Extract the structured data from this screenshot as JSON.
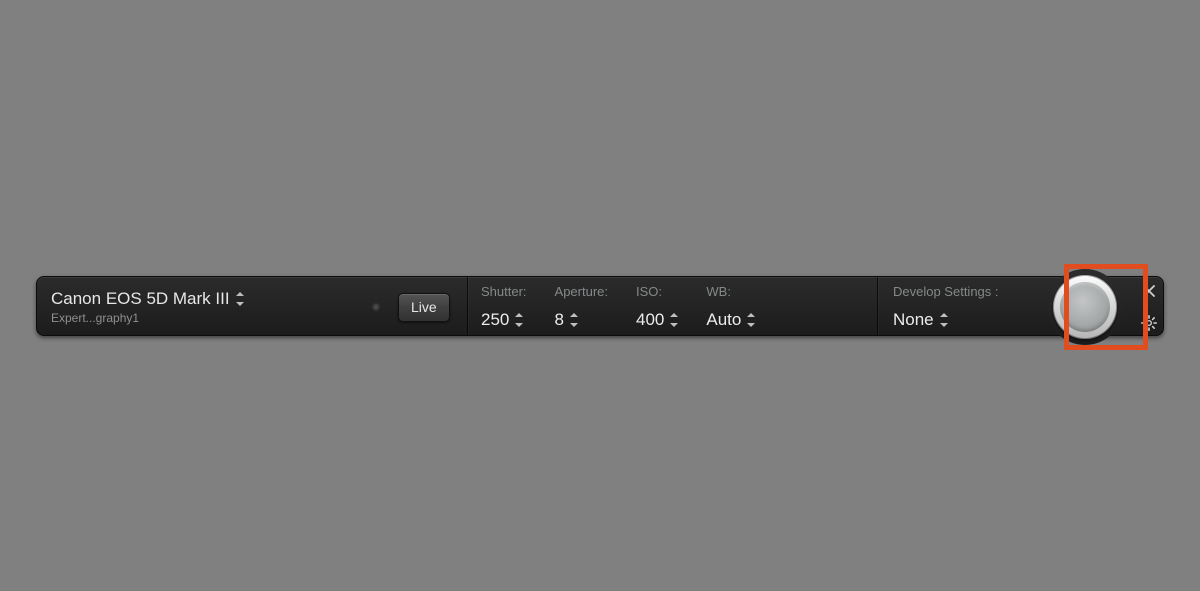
{
  "camera": {
    "name": "Canon EOS 5D Mark III",
    "session": "Expert...graphy1"
  },
  "buttons": {
    "live": "Live"
  },
  "settings": {
    "shutter": {
      "label": "Shutter:",
      "value": "250"
    },
    "aperture": {
      "label": "Aperture:",
      "value": "8"
    },
    "iso": {
      "label": "ISO:",
      "value": "400"
    },
    "wb": {
      "label": "WB:",
      "value": "Auto"
    }
  },
  "develop": {
    "label": "Develop Settings :",
    "value": "None"
  },
  "highlight_color": "#e24d1f"
}
